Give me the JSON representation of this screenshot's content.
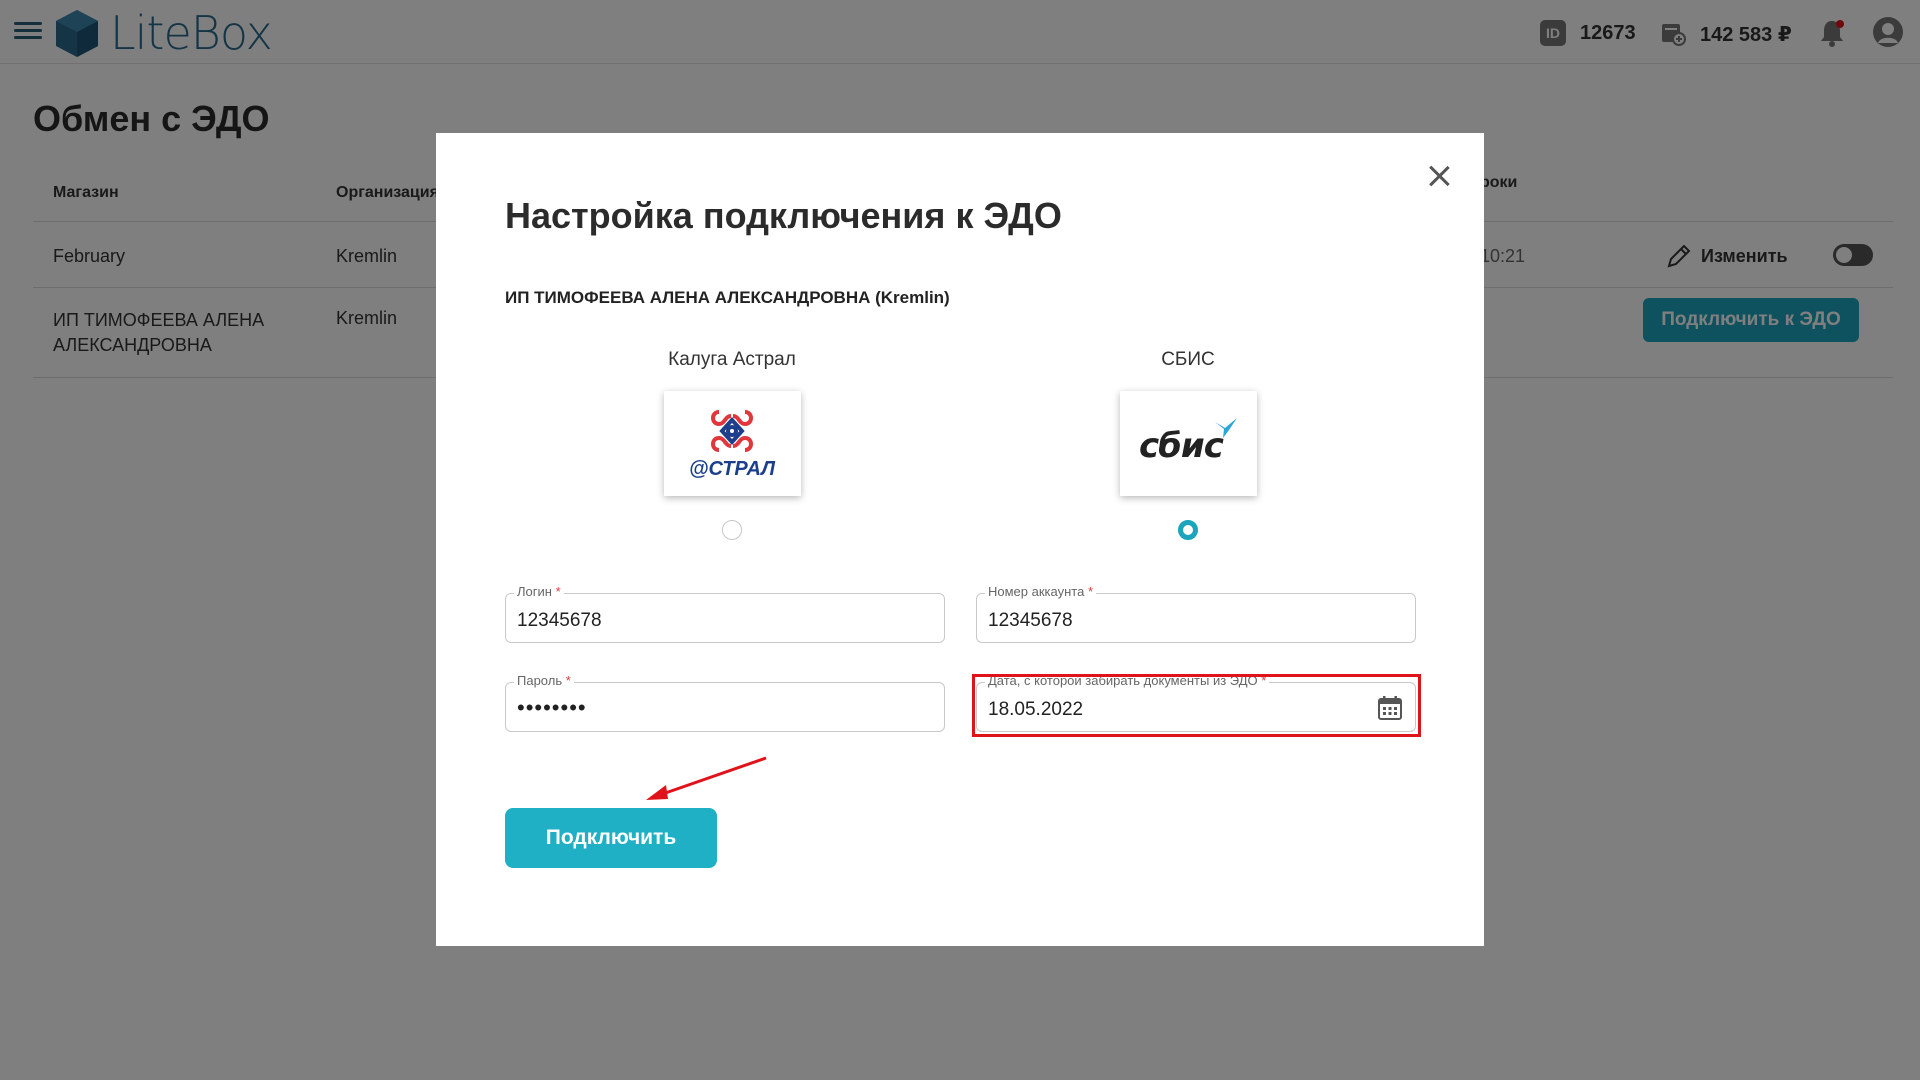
{
  "header": {
    "brand": "LiteBox",
    "id_label": "ID",
    "id_value": "12673",
    "balance": "142 583 ₽"
  },
  "page": {
    "title": "Обмен с ЭДО",
    "columns": [
      "Магазин",
      "Организация",
      "роки"
    ],
    "rows": [
      {
        "store": "February",
        "org": "Kremlin",
        "time": "10:21",
        "action": "Изменить"
      },
      {
        "store_line1": "ИП ТИМОФЕЕВА АЛЕНА",
        "store_line2": "АЛЕКСАНДРОВНА",
        "org": "Kremlin",
        "action": "Подключить к ЭДО"
      }
    ]
  },
  "modal": {
    "title": "Настройка подключения к ЭДО",
    "org_name": "ИП ТИМОФЕЕВА АЛЕНА АЛЕКСАНДРОВНА (Kremlin)",
    "providers": [
      {
        "label": "Калуга Астрал",
        "logo_text": "@СТРАЛ",
        "selected": false
      },
      {
        "label": "СБИС",
        "logo_text": "сбис",
        "selected": true
      }
    ],
    "fields": {
      "login": {
        "label": "Логин",
        "value": "12345678"
      },
      "account": {
        "label": "Номер аккаунта",
        "value": "12345678"
      },
      "password": {
        "label": "Пароль",
        "value": "••••••••"
      },
      "date": {
        "label": "Дата, с которой забирать документы из ЭДО",
        "value": "18.05.2022"
      }
    },
    "required_mark": "*",
    "submit_label": "Подключить"
  },
  "colors": {
    "accent": "#1fb0c5",
    "brand": "#2a6a8e",
    "highlight": "#e0121a"
  }
}
